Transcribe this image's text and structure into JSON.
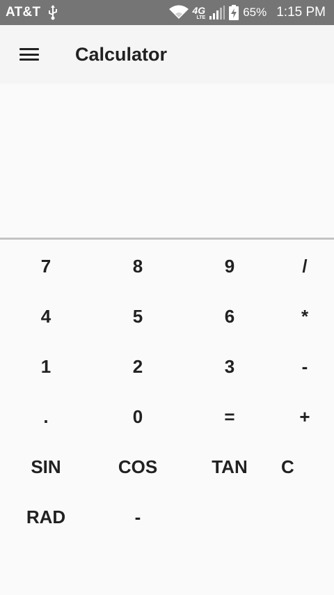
{
  "status_bar": {
    "carrier": "AT&T",
    "network": "4G",
    "network_sub": "LTE",
    "battery_percent": "65%",
    "time": "1:15 PM",
    "icons": [
      "usb-icon",
      "wifi-icon",
      "signal-icon",
      "battery-charging-icon"
    ]
  },
  "app_bar": {
    "menu_icon": "hamburger-menu-icon",
    "title": "Calculator"
  },
  "display": {
    "value": ""
  },
  "keypad": {
    "rows": [
      [
        "7",
        "8",
        "9",
        "/"
      ],
      [
        "4",
        "5",
        "6",
        "*"
      ],
      [
        "1",
        "2",
        "3",
        "-"
      ],
      [
        ".",
        "0",
        "=",
        "+"
      ],
      [
        "SIN",
        "COS",
        "TAN",
        "C"
      ],
      [
        "RAD",
        "-",
        "",
        ""
      ]
    ]
  },
  "colors": {
    "status_bar_bg": "#757575",
    "app_bar_bg": "#f5f5f5",
    "background": "#fafafa",
    "text": "#212121",
    "divider": "#c4c4c4"
  }
}
